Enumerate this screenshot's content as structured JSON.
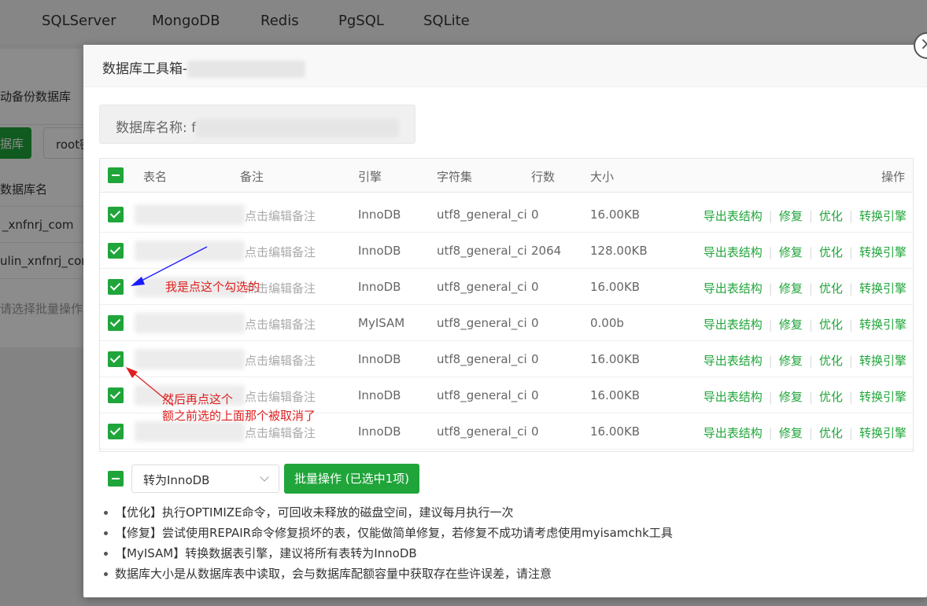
{
  "background": {
    "nav_tabs": [
      "SQLServer",
      "MongoDB",
      "Redis",
      "PgSQL",
      "SQLite"
    ],
    "panel_title": "动备份数据库",
    "green_button": "据库",
    "user_button": "root密",
    "column_header": "数据库名",
    "db_rows": [
      "_xnfnrj_com",
      "ulin_xnfnrj_com"
    ],
    "batch_placeholder": "请选择批量操作"
  },
  "modal": {
    "title": "数据库工具箱-",
    "db_name_label": "数据库名称: f",
    "columns": {
      "name": "表名",
      "remark": "备注",
      "engine": "引擎",
      "charset": "字符集",
      "rows": "行数",
      "size": "大小",
      "ops": "操作"
    },
    "rows": [
      {
        "remark": "点击编辑备注",
        "engine": "InnoDB",
        "charset": "utf8_general_ci",
        "rows": "0",
        "size": "16.00KB"
      },
      {
        "remark": "点击编辑备注",
        "engine": "InnoDB",
        "charset": "utf8_general_ci",
        "rows": "2064",
        "size": "128.00KB"
      },
      {
        "remark": "点击编辑备注",
        "engine": "InnoDB",
        "charset": "utf8_general_ci",
        "rows": "0",
        "size": "16.00KB"
      },
      {
        "remark": "点击编辑备注",
        "engine": "MyISAM",
        "charset": "utf8_general_ci",
        "rows": "0",
        "size": "0.00b"
      },
      {
        "remark": "点击编辑备注",
        "engine": "InnoDB",
        "charset": "utf8_general_ci",
        "rows": "0",
        "size": "16.00KB"
      },
      {
        "remark": "点击编辑备注",
        "engine": "InnoDB",
        "charset": "utf8_general_ci",
        "rows": "0",
        "size": "16.00KB"
      },
      {
        "remark": "点击编辑备注",
        "engine": "InnoDB",
        "charset": "utf8_general_ci",
        "rows": "0",
        "size": "16.00KB"
      }
    ],
    "actions": {
      "export": "导出表结构",
      "repair": "修复",
      "optimize": "优化",
      "convert": "转换引擎"
    },
    "select_value": "转为InnoDB",
    "batch_button": "批量操作 (已选中1项)",
    "tips": [
      "【优化】执行OPTIMIZE命令，可回收未释放的磁盘空间，建议每月执行一次",
      "【修复】尝试使用REPAIR命令修复损坏的表，仅能做简单修复，若修复不成功请考虑使用myisamchk工具",
      "【MyISAM】转换数据表引擎，建议将所有表转为InnoDB",
      "数据库大小是从数据库表中读取，会与数据库配额容量中获取存在些许误差，请注意"
    ]
  },
  "annotations": {
    "first": "我是点这个勾选的",
    "second_line1": "然后再点这个",
    "second_line2": "额之前选的上面那个被取消了"
  },
  "colors": {
    "accent": "#20a53a",
    "annotation_red": "#e02020",
    "annotation_blue": "#1a1aff"
  }
}
